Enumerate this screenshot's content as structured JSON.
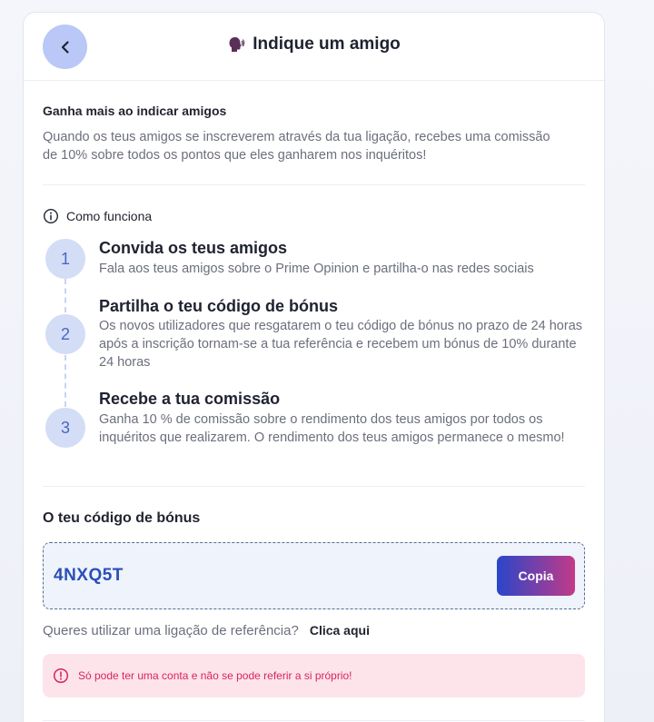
{
  "header": {
    "title": "Indique um amigo",
    "icon": "speaking-head-icon",
    "back_icon": "chevron-left-icon"
  },
  "intro": {
    "title": "Ganha mais ao indicar amigos",
    "text": "Quando os teus amigos se inscreverem através da tua ligação, recebes uma comissão de 10% sobre todos os pontos que eles ganharem nos inquéritos!"
  },
  "how": {
    "label": "Como funciona",
    "icon": "info-icon",
    "steps": [
      {
        "number": "1",
        "title": "Convida os teus amigos",
        "desc": "Fala aos teus amigos sobre o Prime Opinion e partilha-o nas redes sociais"
      },
      {
        "number": "2",
        "title": "Partilha o teu código de bónus",
        "desc": "Os novos utilizadores que resgatarem o teu código de bónus no prazo de 24 horas após a inscrição tornam-se a tua referência e recebem um bónus de 10% durante 24 horas"
      },
      {
        "number": "3",
        "title": "Recebe a tua comissão",
        "desc": "Ganha 10 % de comissão sobre o rendimento dos teus amigos por todos os inquéritos que realizarem. O rendimento dos teus amigos permanece o mesmo!"
      }
    ]
  },
  "bonus": {
    "title": "O teu código de bónus",
    "code": "4NXQ5T",
    "copy_label": "Copia"
  },
  "referral": {
    "question": "Queres utilizar uma ligação de referência?",
    "link_label": "Clica aqui"
  },
  "alert": {
    "icon": "alert-circle-icon",
    "message": "Só pode ter uma conta e não se pode referir a si próprio!"
  },
  "colors": {
    "accent": "#2b4fb6",
    "back_button": "#b9c8f7",
    "alert_bg": "#fde4ea",
    "alert_text": "#d9245d",
    "gradient_start": "#2a46c9",
    "gradient_end": "#c23a88"
  }
}
